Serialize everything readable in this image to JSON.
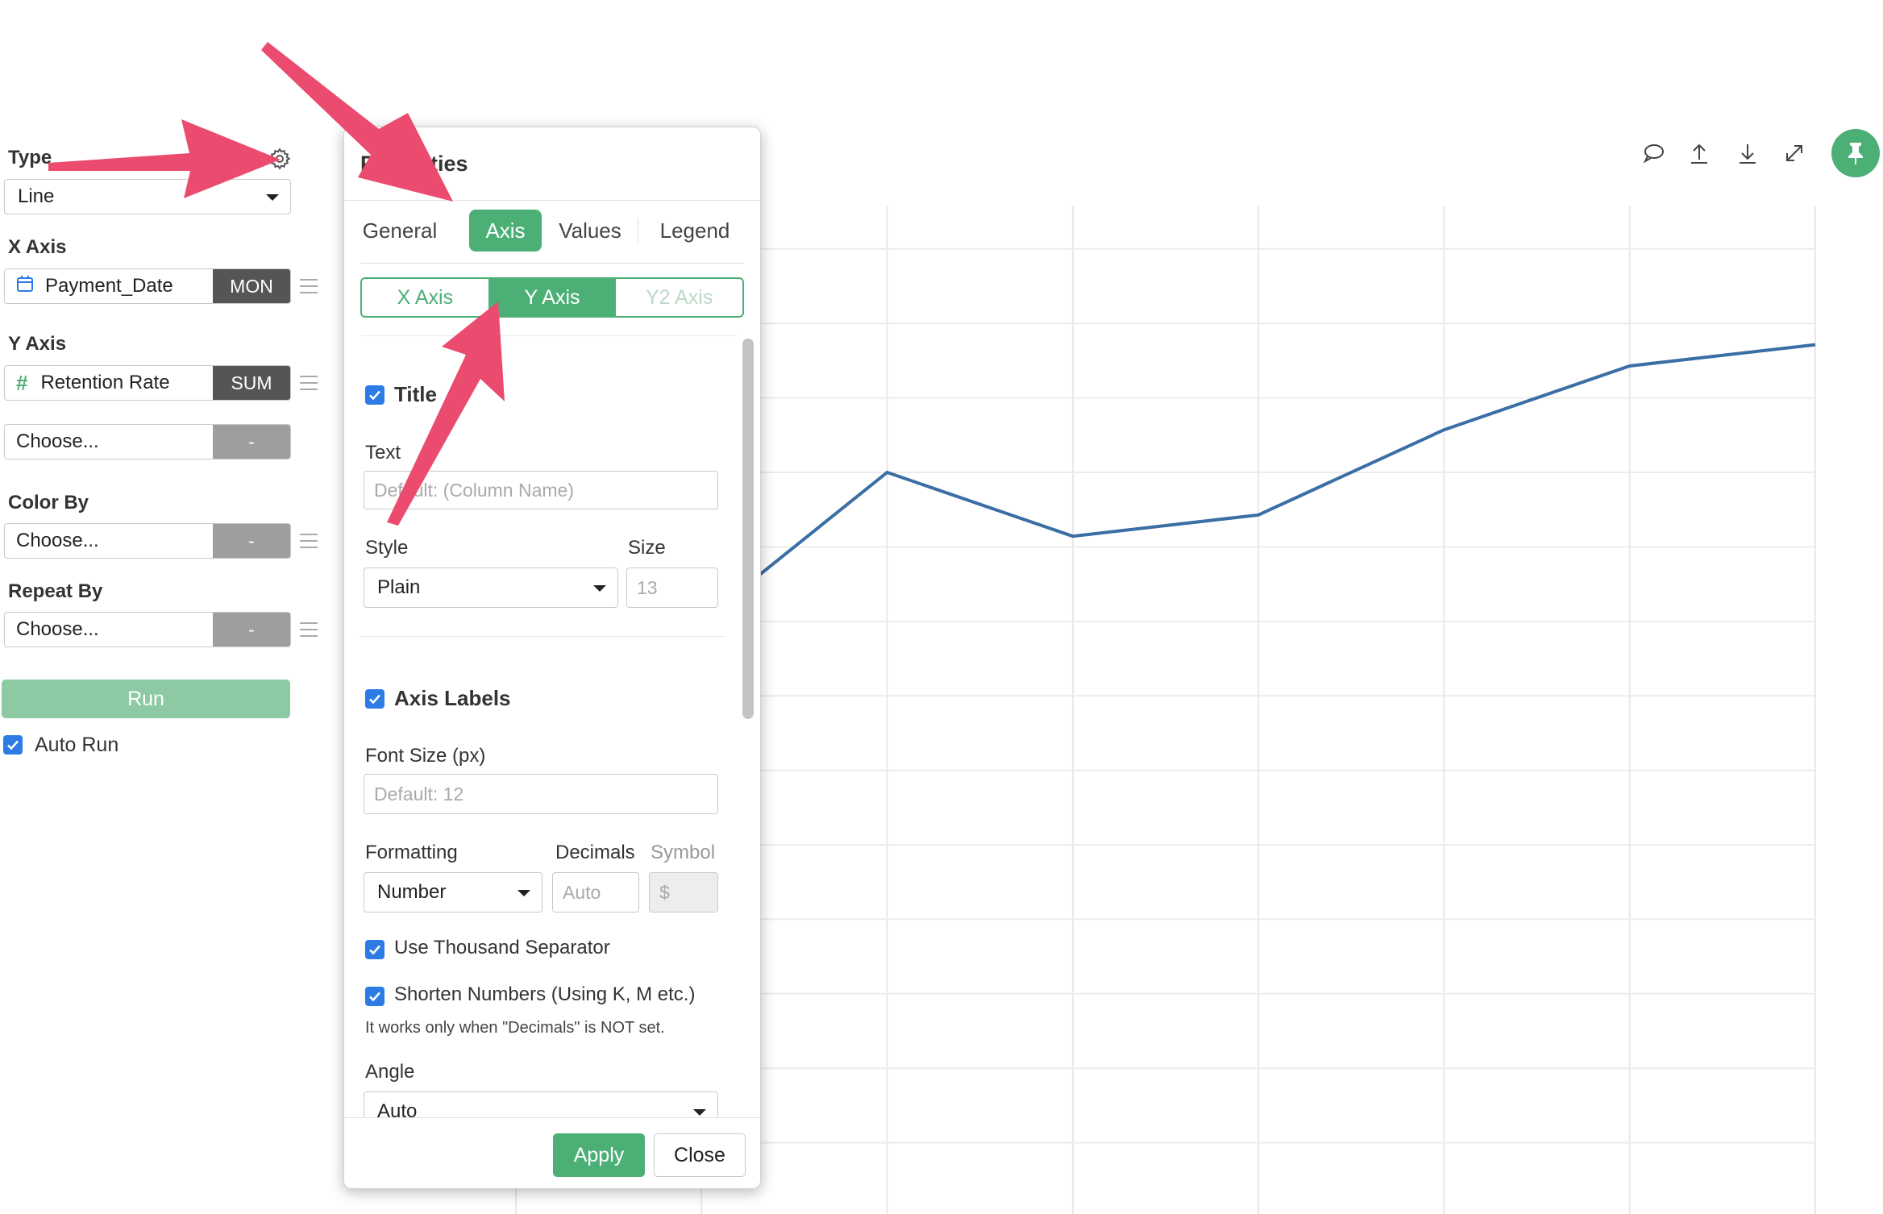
{
  "sidebar": {
    "type_label": "Type",
    "type_value": "Line",
    "x_axis_label": "X Axis",
    "x_axis_field": "Payment_Date",
    "x_axis_agg": "MON",
    "y_axis_label": "Y Axis",
    "y_axis_field": "Retention Rate",
    "y_axis_agg": "SUM",
    "y_axis_extra": "Choose...",
    "y_axis_extra_agg": "-",
    "color_by_label": "Color By",
    "color_by_value": "Choose...",
    "color_by_agg": "-",
    "repeat_by_label": "Repeat By",
    "repeat_by_value": "Choose...",
    "repeat_by_agg": "-",
    "run_label": "Run",
    "auto_run_label": "Auto Run",
    "auto_run_checked": true
  },
  "toolbar": {
    "icons": [
      "comment-icon",
      "upload-icon",
      "download-icon",
      "expand-icon",
      "pin-icon"
    ],
    "accent": "#4caf76"
  },
  "dialog": {
    "title": "Properties",
    "tabs": [
      "General",
      "Axis",
      "Values",
      "Legend"
    ],
    "active_tab": "Axis",
    "axis_tabs": [
      "X Axis",
      "Y Axis",
      "Y2 Axis"
    ],
    "active_axis_tab": "Y Axis",
    "title_section": {
      "label": "Title",
      "checked": true,
      "text_label": "Text",
      "text_placeholder": "Default: (Column Name)",
      "style_label": "Style",
      "style_value": "Plain",
      "size_label": "Size",
      "size_placeholder": "13"
    },
    "axis_labels_section": {
      "label": "Axis Labels",
      "checked": true,
      "font_size_label": "Font Size (px)",
      "font_size_placeholder": "Default: 12",
      "formatting_label": "Formatting",
      "formatting_value": "Number",
      "decimals_label": "Decimals",
      "decimals_placeholder": "Auto",
      "symbol_label": "Symbol",
      "symbol_placeholder": "$",
      "thousand_sep_label": "Use Thousand Separator",
      "thousand_sep_checked": true,
      "shorten_label": "Shorten Numbers (Using K, M etc.)",
      "shorten_checked": true,
      "shorten_hint": "It works only when \"Decimals\" is NOT set.",
      "angle_label": "Angle",
      "angle_value": "Auto"
    },
    "apply_label": "Apply",
    "close_label": "Close"
  },
  "chart_data": {
    "type": "line",
    "series": [
      {
        "values": [
          30,
          28,
          35,
          32,
          33,
          37,
          40,
          41
        ]
      }
    ],
    "ylim": [
      0,
      50
    ],
    "grid": true,
    "line_color": "#3a6ea5"
  },
  "annotations": {
    "arrow_color": "#ea4b6f"
  }
}
